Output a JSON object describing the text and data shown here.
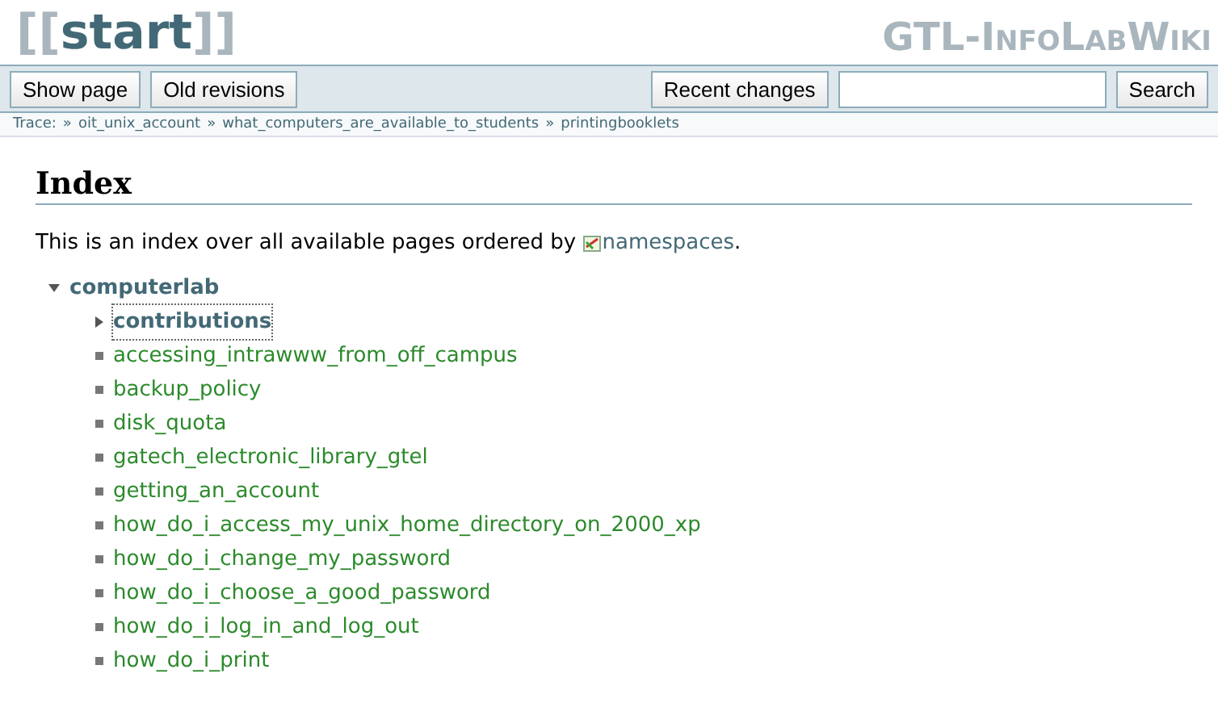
{
  "header": {
    "title": {
      "open": "[[",
      "text": "start",
      "close": "]]"
    },
    "logo": "GTL-InfoLabWiki"
  },
  "toolbar": {
    "buttons": [
      "Show page",
      "Old revisions"
    ],
    "right_buttons": [
      "Recent changes"
    ],
    "search": {
      "button": "Search"
    }
  },
  "trace": {
    "label": "Trace:",
    "separator": "»",
    "items": [
      "oit_unix_account",
      "what_computers_are_available_to_students",
      "printingbooklets"
    ]
  },
  "content": {
    "heading": "Index",
    "intro": "This is an index over all available pages ordered by",
    "intro_link": "namespaces",
    "intro_end": ".",
    "tree": [
      {
        "kind": "namespace",
        "label": "computerlab",
        "expanded": true,
        "children": [
          {
            "kind": "namespace",
            "label": "contributions",
            "expanded": false,
            "focused": true
          },
          {
            "kind": "page",
            "label": "accessing_intrawww_from_off_campus"
          },
          {
            "kind": "page",
            "label": "backup_policy"
          },
          {
            "kind": "page",
            "label": "disk_quota"
          },
          {
            "kind": "page",
            "label": "gatech_electronic_library_gtel"
          },
          {
            "kind": "page",
            "label": "getting_an_account"
          },
          {
            "kind": "page",
            "label": "how_do_i_access_my_unix_home_directory_on_2000_xp"
          },
          {
            "kind": "page",
            "label": "how_do_i_change_my_password"
          },
          {
            "kind": "page",
            "label": "how_do_i_choose_a_good_password"
          },
          {
            "kind": "page",
            "label": "how_do_i_log_in_and_log_out"
          },
          {
            "kind": "page",
            "label": "how_do_i_print"
          }
        ]
      }
    ]
  }
}
